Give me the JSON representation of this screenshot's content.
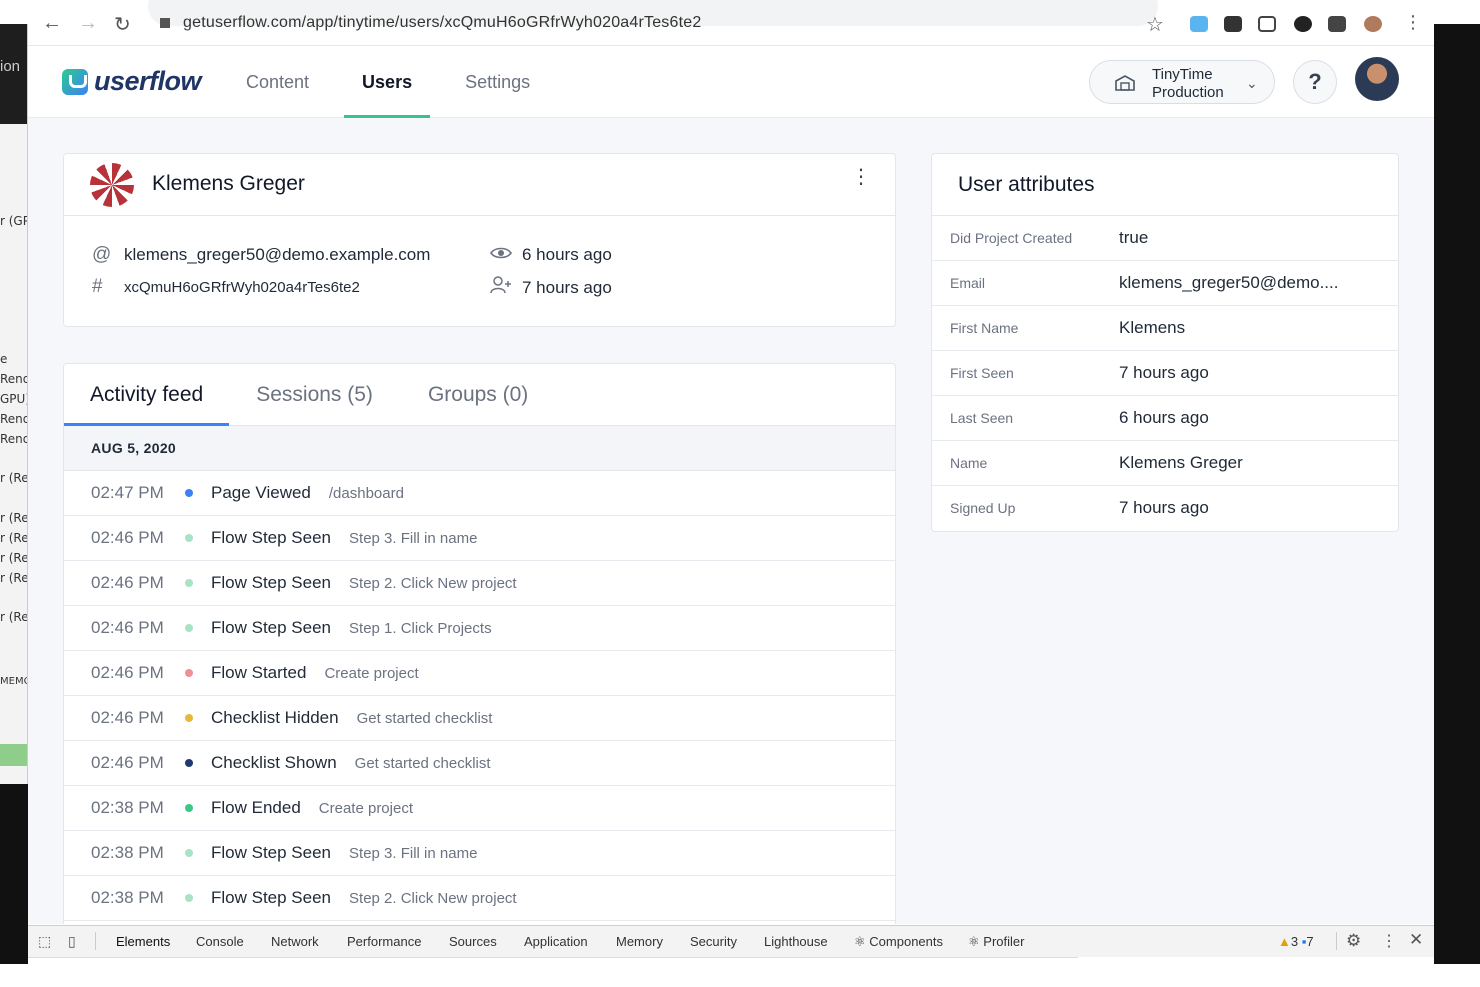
{
  "browser": {
    "url": "getuserflow.com/app/tinytime/users/xcQmuH6oGRfrWyh020a4rTes6te2"
  },
  "app": {
    "logo_text": "userflow",
    "nav": [
      {
        "label": "Content",
        "active": false
      },
      {
        "label": "Users",
        "active": true
      },
      {
        "label": "Settings",
        "active": false
      }
    ],
    "environment": {
      "line1": "TinyTime",
      "line2": "Production"
    },
    "help_label": "?"
  },
  "user": {
    "name": "Klemens Greger",
    "email": "klemens_greger50@demo.example.com",
    "id": "xcQmuH6oGRfrWyh020a4rTes6te2",
    "last_seen": "6 hours ago",
    "signed_up": "7 hours ago"
  },
  "activity": {
    "tabs": [
      {
        "label": "Activity feed",
        "active": true
      },
      {
        "label": "Sessions (5)",
        "active": false
      },
      {
        "label": "Groups (0)",
        "active": false
      }
    ],
    "date": "AUG 5, 2020",
    "events": [
      {
        "time": "02:47 PM",
        "color": "#3b82f6",
        "name": "Page Viewed",
        "detail": "/dashboard"
      },
      {
        "time": "02:46 PM",
        "color": "#a7e3c5",
        "name": "Flow Step Seen",
        "detail": "Step 3. Fill in name"
      },
      {
        "time": "02:46 PM",
        "color": "#a7e3c5",
        "name": "Flow Step Seen",
        "detail": "Step 2. Click New project"
      },
      {
        "time": "02:46 PM",
        "color": "#a7e3c5",
        "name": "Flow Step Seen",
        "detail": "Step 1. Click Projects"
      },
      {
        "time": "02:46 PM",
        "color": "#ef8f99",
        "name": "Flow Started",
        "detail": "Create project"
      },
      {
        "time": "02:46 PM",
        "color": "#e5b93c",
        "name": "Checklist Hidden",
        "detail": "Get started checklist"
      },
      {
        "time": "02:46 PM",
        "color": "#1e3a6e",
        "name": "Checklist Shown",
        "detail": "Get started checklist"
      },
      {
        "time": "02:38 PM",
        "color": "#3cc883",
        "name": "Flow Ended",
        "detail": "Create project"
      },
      {
        "time": "02:38 PM",
        "color": "#a7e3c5",
        "name": "Flow Step Seen",
        "detail": "Step 3. Fill in name"
      },
      {
        "time": "02:38 PM",
        "color": "#a7e3c5",
        "name": "Flow Step Seen",
        "detail": "Step 2. Click New project"
      }
    ]
  },
  "attributes": {
    "title": "User attributes",
    "rows": [
      {
        "key": "Did Project Created",
        "value": "true"
      },
      {
        "key": "Email",
        "value": "klemens_greger50@demo...."
      },
      {
        "key": "First Name",
        "value": "Klemens"
      },
      {
        "key": "First Seen",
        "value": "7 hours ago"
      },
      {
        "key": "Last Seen",
        "value": "6 hours ago"
      },
      {
        "key": "Name",
        "value": "Klemens Greger"
      },
      {
        "key": "Signed Up",
        "value": "7 hours ago"
      }
    ]
  },
  "devtools": {
    "tabs": [
      "Elements",
      "Console",
      "Network",
      "Performance",
      "Sources",
      "Application",
      "Memory",
      "Security",
      "Lighthouse",
      "Components",
      "Profiler"
    ],
    "warnings": "3",
    "messages": "7"
  },
  "side_panel": {
    "top": "ion",
    "lines": [
      "r (GP",
      "e",
      "Rend",
      "GPU)",
      "Rend",
      "Rend",
      "r (Re",
      "r (Re",
      "r (Re",
      "r (Re",
      "r (Re",
      "r (Re",
      "MEMO"
    ]
  }
}
